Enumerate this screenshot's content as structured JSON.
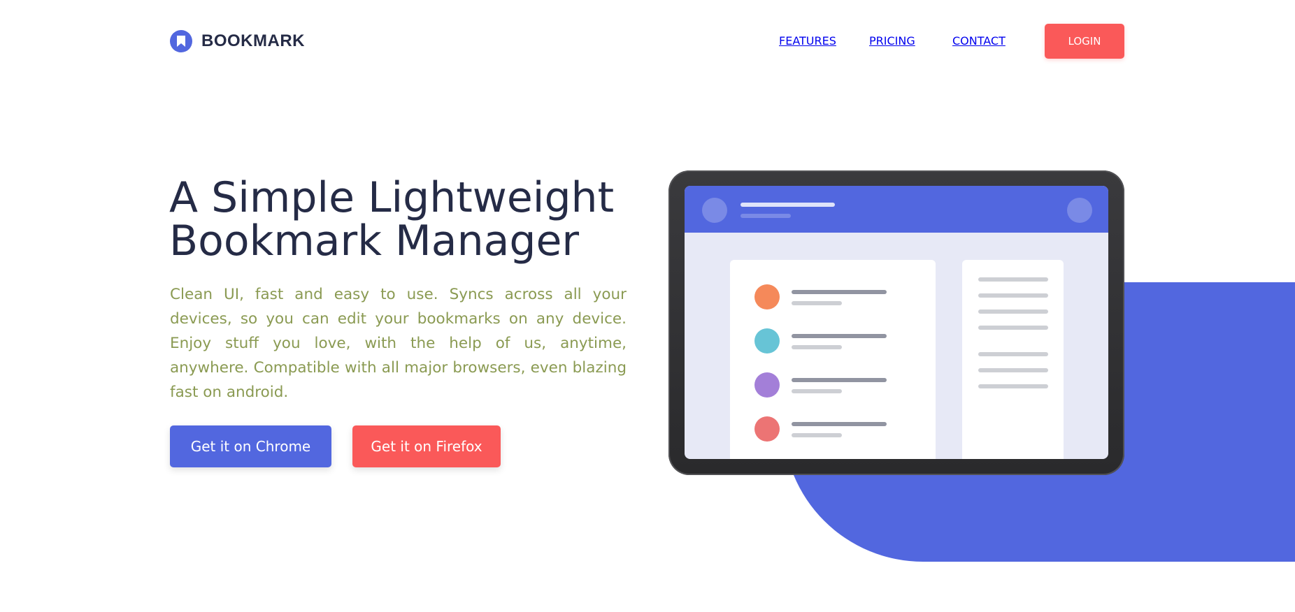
{
  "brand": {
    "name": "BOOKMARK",
    "icon": "bookmark-icon",
    "color": "#5267df"
  },
  "nav": {
    "items": [
      "FEATURES",
      "PRICING",
      "CONTACT"
    ],
    "login": "LOGIN"
  },
  "hero": {
    "title": "A Simple Lightweight Bookmark Manager",
    "description": "Clean UI, fast and easy to use. Syncs across all your devices, so you can edit your bookmarks on any device. Enjoy stuff you love, with the help of us, anytime, anywhere. Compatible with all major browsers, even blazing fast on android.",
    "cta_chrome": "Get it on Chrome",
    "cta_firefox": "Get it on Firefox"
  },
  "colors": {
    "primary": "#5267df",
    "accent": "#fa5959",
    "text": "#252b46",
    "description": "#8a9a52",
    "list_dots": [
      "#f5895a",
      "#67c4d6",
      "#a37fd8",
      "#ec7474"
    ]
  }
}
